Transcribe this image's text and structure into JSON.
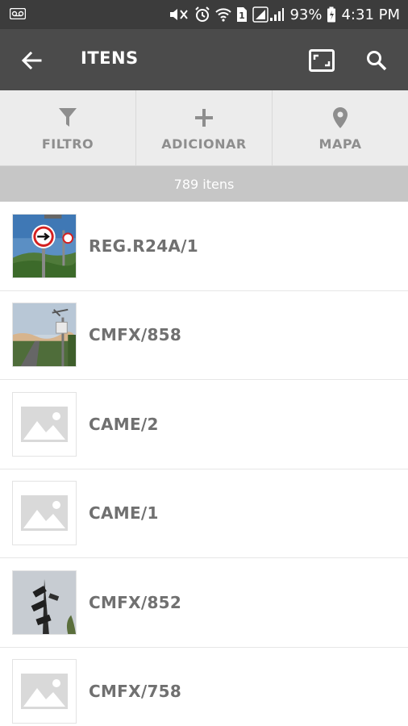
{
  "status_bar": {
    "battery": "93%",
    "time": "4:31 PM",
    "icons": [
      "voicemail-icon",
      "mute-icon",
      "alarm-icon",
      "wifi-icon",
      "sim-icon",
      "signal-icon",
      "battery-icon"
    ]
  },
  "app_bar": {
    "title": "ITENS",
    "icons": [
      "back-arrow-icon",
      "expand-icon",
      "search-icon"
    ]
  },
  "actions": [
    {
      "label": "FILTRO",
      "icon": "filter-icon"
    },
    {
      "label": "ADICIONAR",
      "icon": "plus-icon"
    },
    {
      "label": "MAPA",
      "icon": "map-pin-icon"
    }
  ],
  "count_text": "789 itens",
  "items": [
    {
      "label": "REG.R24A/1",
      "thumbnail": "photo"
    },
    {
      "label": "CMFX/858",
      "thumbnail": "photo"
    },
    {
      "label": "CAME/2",
      "thumbnail": "placeholder"
    },
    {
      "label": "CAME/1",
      "thumbnail": "placeholder"
    },
    {
      "label": "CMFX/852",
      "thumbnail": "photo"
    },
    {
      "label": "CMFX/758",
      "thumbnail": "placeholder"
    }
  ],
  "colors": {
    "status_bar": "#3c3c3c",
    "app_bar": "#4b4b4b",
    "action_bar": "#ececec",
    "count_bar": "#c6c6c6",
    "label_text": "#707070"
  }
}
